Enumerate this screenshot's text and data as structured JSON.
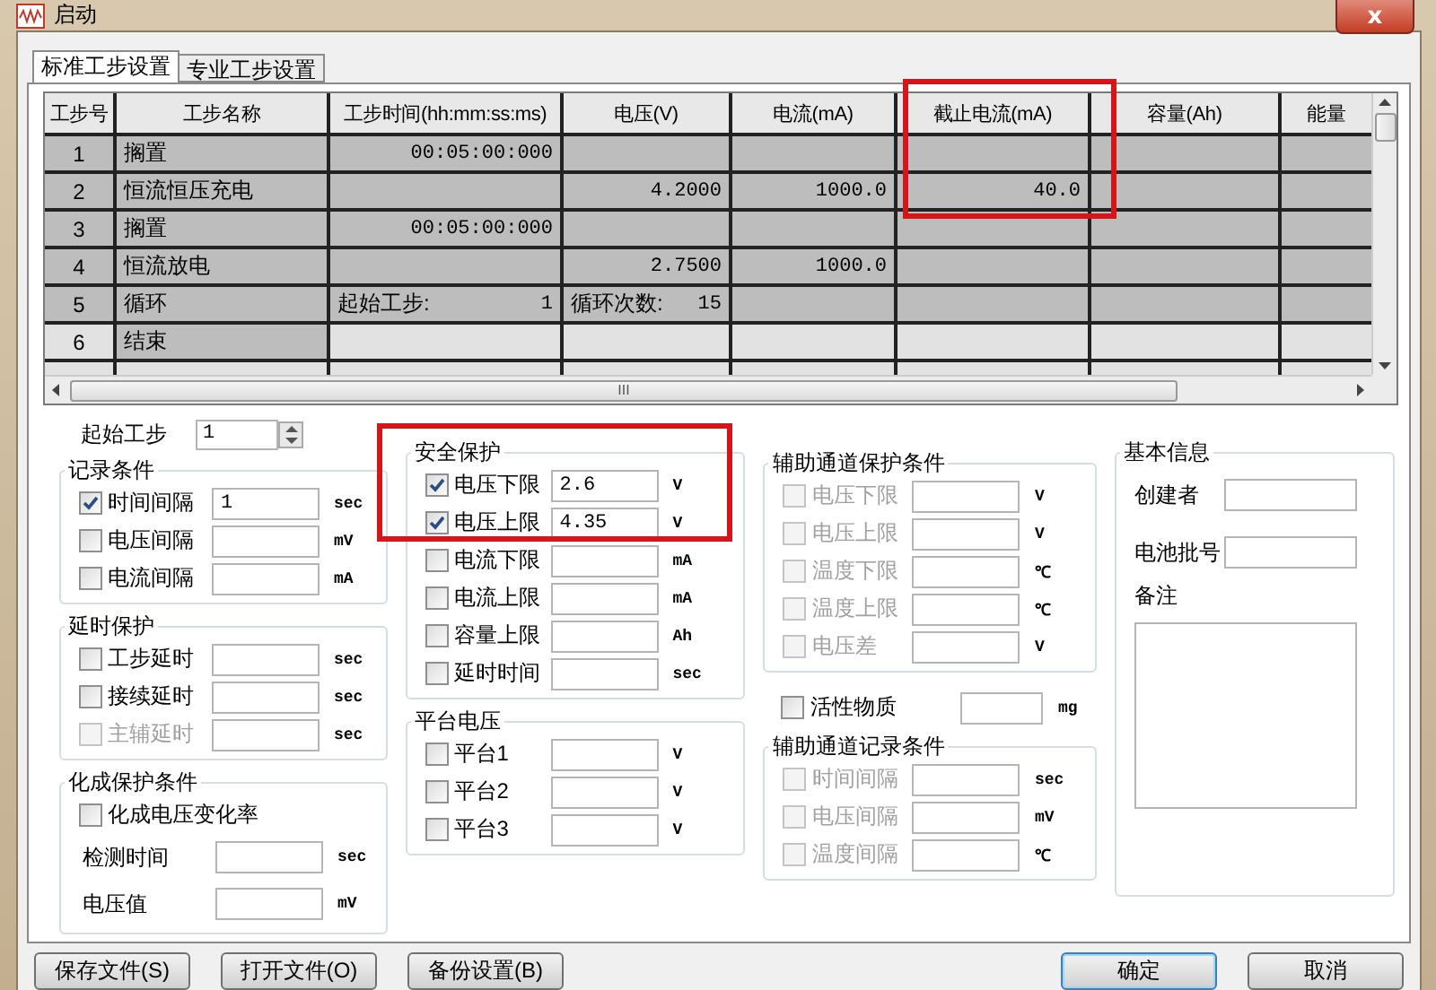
{
  "window": {
    "title": "启动",
    "close": "x"
  },
  "tabs": [
    {
      "label": "标准工步设置",
      "selected": true
    },
    {
      "label": "专业工步设置",
      "selected": false
    }
  ],
  "table": {
    "columns": [
      "工步号",
      "工步名称",
      "工步时间(hh:mm:ss:ms)",
      "电压(V)",
      "电流(mA)",
      "截止电流(mA)",
      "容量(Ah)",
      "能量"
    ],
    "rows": [
      {
        "active": true,
        "cells": [
          "1",
          "搁置",
          "00:05:00:000",
          null,
          null,
          null,
          null,
          null
        ]
      },
      {
        "active": true,
        "cells": [
          "2",
          "恒流恒压充电",
          null,
          "4.2000",
          "1000.0",
          "40.0",
          null,
          null
        ]
      },
      {
        "active": true,
        "cells": [
          "3",
          "搁置",
          "00:05:00:000",
          null,
          null,
          null,
          null,
          null
        ]
      },
      {
        "active": true,
        "cells": [
          "4",
          "恒流放电",
          null,
          "2.7500",
          "1000.0",
          null,
          null,
          null
        ]
      },
      {
        "active": true,
        "cells": [
          "5",
          "循环",
          {
            "label": "起始工步:",
            "value": "1"
          },
          {
            "label": "循环次数:",
            "value": "15"
          },
          null,
          null,
          null,
          null
        ]
      },
      {
        "active": false,
        "cells": [
          "6",
          "结束",
          null,
          null,
          null,
          null,
          null,
          null
        ]
      }
    ],
    "scroll_grip": "III"
  },
  "start_step": {
    "label": "起始工步",
    "value": "1"
  },
  "left": [
    {
      "kind": "group",
      "title": "记录条件",
      "rows": [
        {
          "kind": "check",
          "label": "时间间隔",
          "checked": true,
          "disabled": false,
          "value": "1",
          "unit": "sec"
        },
        {
          "kind": "check",
          "label": "电压间隔",
          "checked": false,
          "disabled": false,
          "unit": "mV"
        },
        {
          "kind": "check",
          "label": "电流间隔",
          "checked": false,
          "disabled": false,
          "unit": "mA"
        }
      ]
    },
    {
      "kind": "group",
      "title": "延时保护",
      "rows": [
        {
          "kind": "check",
          "label": "工步延时",
          "checked": false,
          "disabled": false,
          "unit": "sec"
        },
        {
          "kind": "check",
          "label": "接续延时",
          "checked": false,
          "disabled": false,
          "unit": "sec"
        },
        {
          "kind": "check",
          "label": "主辅延时",
          "checked": false,
          "disabled": true,
          "unit": "sec"
        }
      ]
    },
    {
      "kind": "group",
      "title": "化成保护条件",
      "rows": [
        {
          "kind": "checkonly",
          "label": "化成电压变化率",
          "checked": false,
          "disabled": false
        },
        {
          "kind": "plain",
          "label": "检测时间",
          "unit": "sec"
        },
        {
          "kind": "plain",
          "label": "电压值",
          "unit": "mV"
        }
      ]
    }
  ],
  "middle": [
    {
      "kind": "group",
      "title": "安全保护",
      "rows": [
        {
          "kind": "check",
          "label": "电压下限",
          "checked": true,
          "disabled": false,
          "value": "2.6",
          "unit": "V"
        },
        {
          "kind": "check",
          "label": "电压上限",
          "checked": true,
          "disabled": false,
          "value": "4.35",
          "unit": "V"
        },
        {
          "kind": "check",
          "label": "电流下限",
          "checked": false,
          "disabled": false,
          "unit": "mA"
        },
        {
          "kind": "check",
          "label": "电流上限",
          "checked": false,
          "disabled": false,
          "unit": "mA"
        },
        {
          "kind": "check",
          "label": "容量上限",
          "checked": false,
          "disabled": false,
          "unit": "Ah"
        },
        {
          "kind": "check",
          "label": "延时时间",
          "checked": false,
          "disabled": false,
          "unit": "sec"
        }
      ]
    },
    {
      "kind": "group",
      "title": "平台电压",
      "rows": [
        {
          "kind": "check",
          "label": "平台1",
          "checked": false,
          "disabled": false,
          "unit": "V"
        },
        {
          "kind": "check",
          "label": "平台2",
          "checked": false,
          "disabled": false,
          "unit": "V"
        },
        {
          "kind": "check",
          "label": "平台3",
          "checked": false,
          "disabled": false,
          "unit": "V"
        }
      ]
    }
  ],
  "aux": [
    {
      "kind": "group",
      "title": "辅助通道保护条件",
      "rows": [
        {
          "kind": "check",
          "label": "电压下限",
          "checked": false,
          "disabled": true,
          "unit": "V"
        },
        {
          "kind": "check",
          "label": "电压上限",
          "checked": false,
          "disabled": true,
          "unit": "V"
        },
        {
          "kind": "check",
          "label": "温度下限",
          "checked": false,
          "disabled": true,
          "unit": "℃"
        },
        {
          "kind": "check",
          "label": "温度上限",
          "checked": false,
          "disabled": true,
          "unit": "℃"
        },
        {
          "kind": "check",
          "label": "电压差",
          "checked": false,
          "disabled": true,
          "unit": "V"
        }
      ]
    },
    {
      "kind": "check",
      "label": "活性物质",
      "checked": false,
      "disabled": false,
      "unit": "mg"
    },
    {
      "kind": "group",
      "title": "辅助通道记录条件",
      "rows": [
        {
          "kind": "check",
          "label": "时间间隔",
          "checked": false,
          "disabled": true,
          "unit": "sec"
        },
        {
          "kind": "check",
          "label": "电压间隔",
          "checked": false,
          "disabled": true,
          "unit": "mV"
        },
        {
          "kind": "check",
          "label": "温度间隔",
          "checked": false,
          "disabled": true,
          "unit": "℃"
        }
      ]
    }
  ],
  "info": {
    "title": "基本信息",
    "fields": [
      "创建者",
      "电池批号"
    ],
    "notes_label": "备注"
  },
  "buttons_left": [
    "保存文件(S)",
    "打开文件(O)",
    "备份设置(B)"
  ],
  "buttons_right": [
    {
      "label": "确定",
      "focused": true
    },
    {
      "label": "取消",
      "focused": false
    }
  ]
}
